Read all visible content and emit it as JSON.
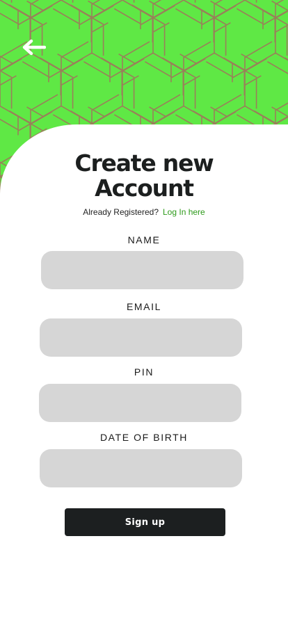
{
  "colors": {
    "accent_green": "#5fe845",
    "pattern_line": "#9a7f5a",
    "link_green": "#2d9a1a",
    "input_bg": "#d6d6d6",
    "button_bg": "#1c1f20"
  },
  "header": {
    "back_icon": "arrow-left-icon"
  },
  "title": {
    "line1": "Create new",
    "line2": "Account"
  },
  "login_prompt": {
    "text": "Already Registered?",
    "link": "Log In here"
  },
  "form": {
    "name_label": "NAME",
    "name_value": "",
    "email_label": "EMAIL",
    "email_value": "",
    "pin_label": "PIN",
    "pin_value": "",
    "dob_label": "DATE OF BIRTH",
    "dob_value": ""
  },
  "signup_button": {
    "label": "Sign up"
  }
}
